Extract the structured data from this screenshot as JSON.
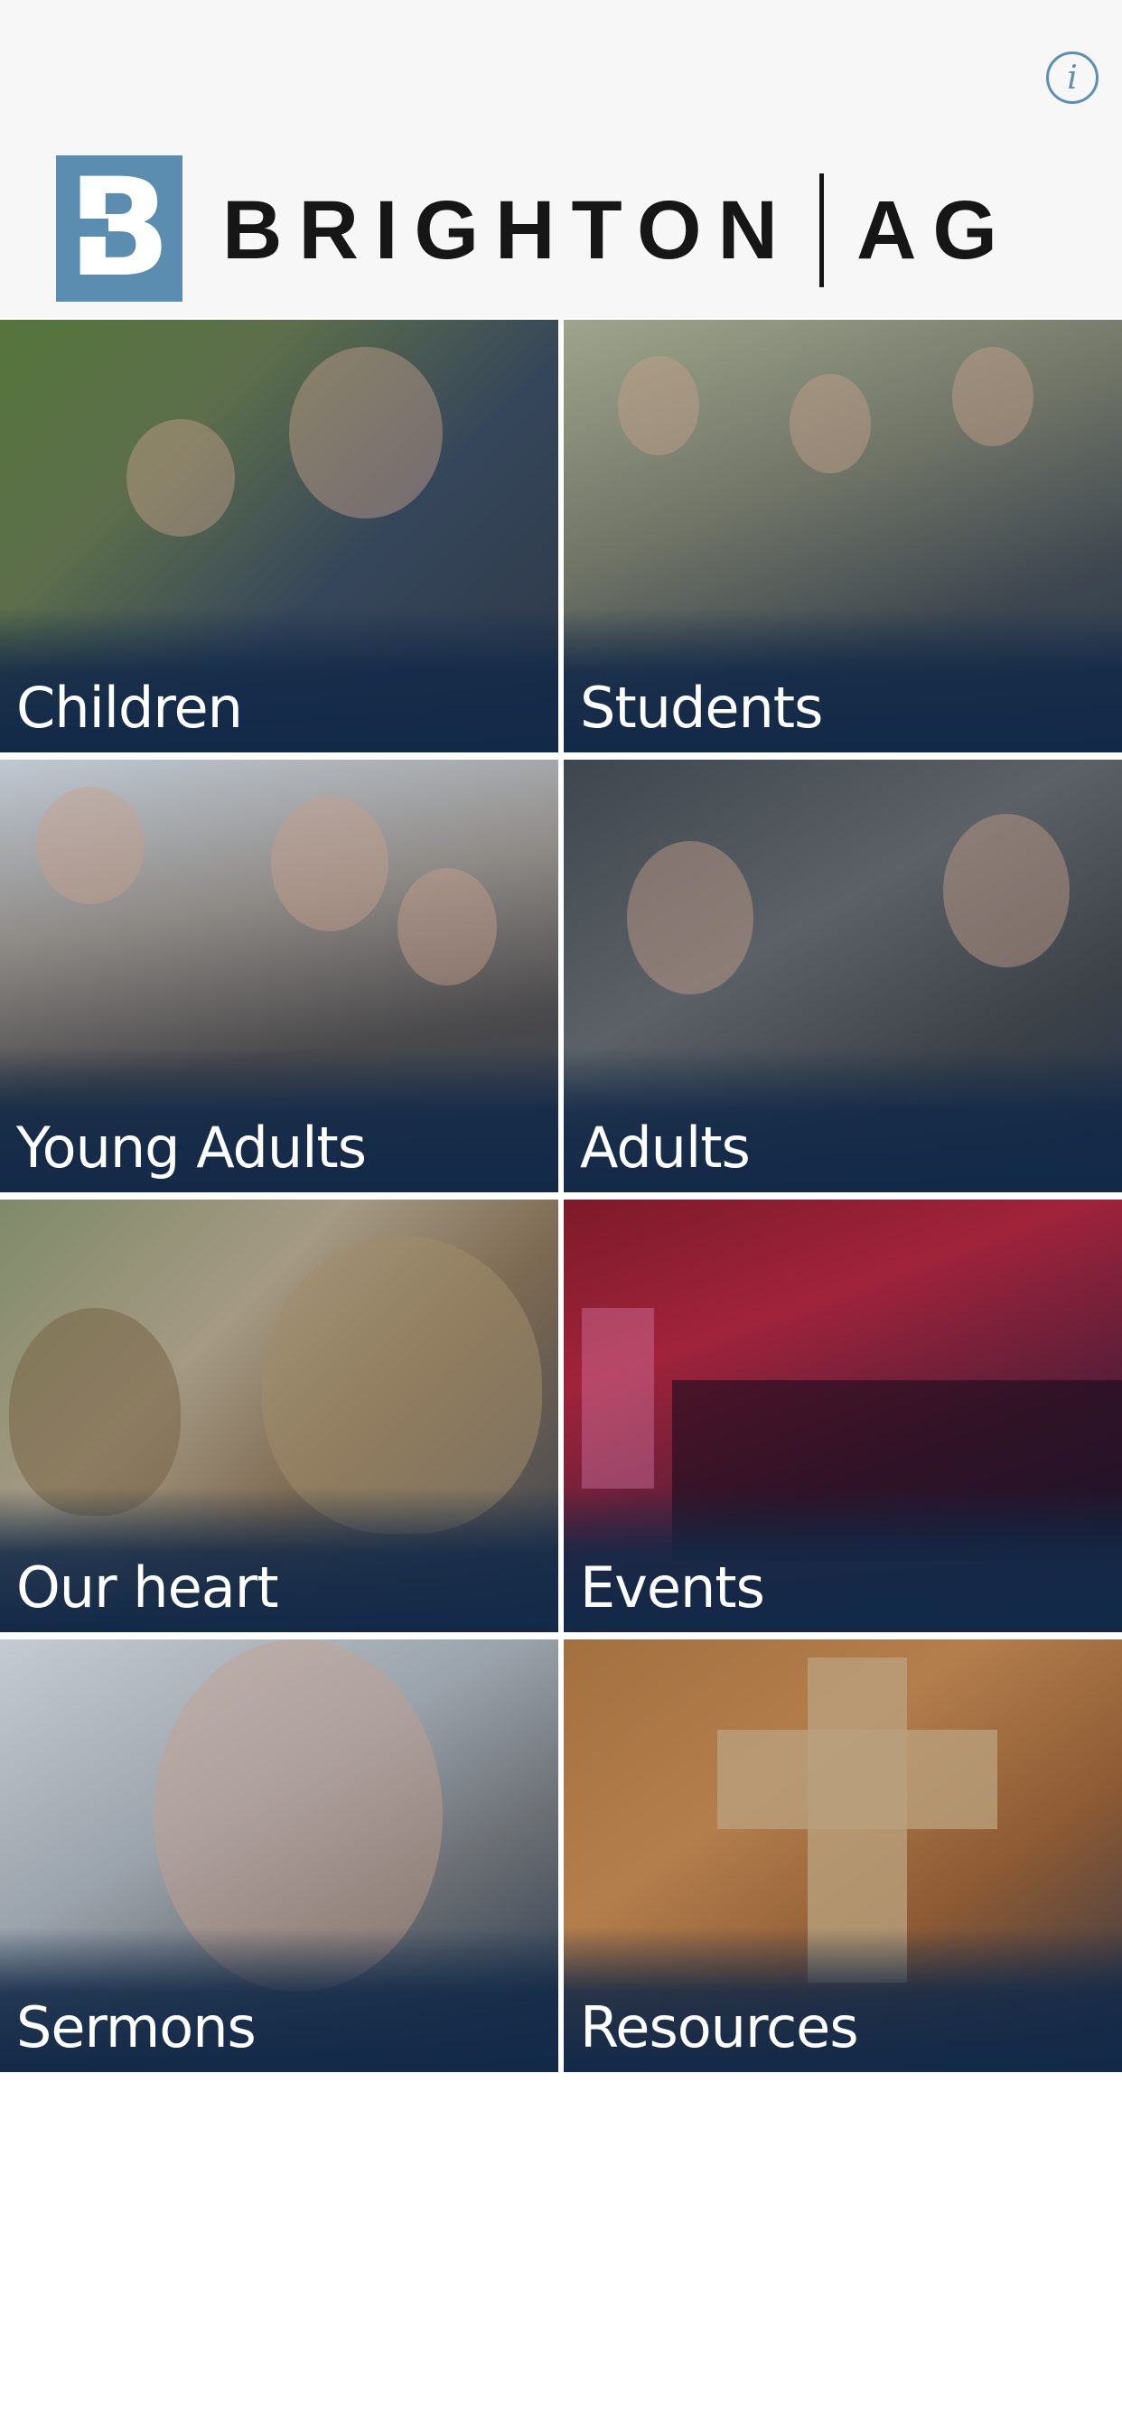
{
  "header": {
    "info_icon": "info-icon",
    "info_glyph": "i",
    "logo_letter": "B",
    "logo_name": "BRIGHTON",
    "logo_suffix": "AG",
    "brand_color": "#5a8db0"
  },
  "tiles": [
    {
      "label": "Children"
    },
    {
      "label": "Students"
    },
    {
      "label": "Young Adults"
    },
    {
      "label": "Adults"
    },
    {
      "label": "Our heart"
    },
    {
      "label": "Events"
    },
    {
      "label": "Sermons"
    },
    {
      "label": "Resources"
    }
  ],
  "colors": {
    "label_overlay": "#122948",
    "label_text": "#ffffff"
  }
}
